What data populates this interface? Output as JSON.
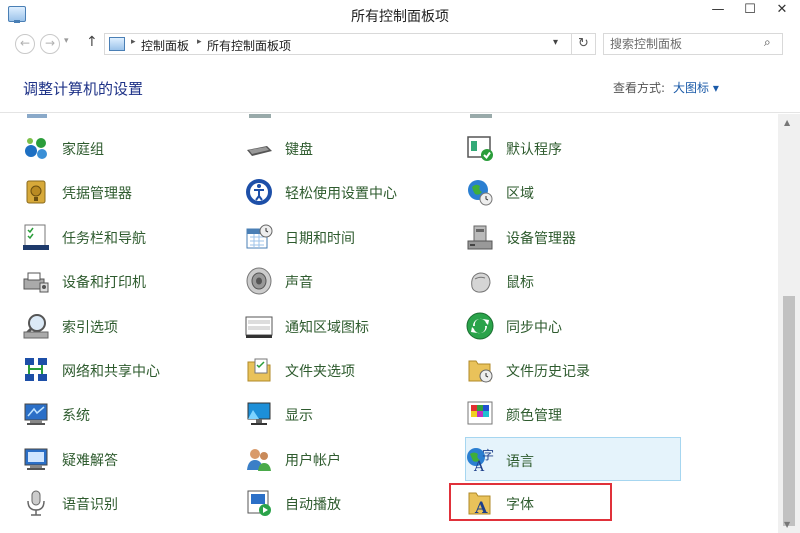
{
  "window": {
    "title": "所有控制面板项",
    "min": "—",
    "max": "☐",
    "close": "✕"
  },
  "nav": {
    "back": "←",
    "forward": "→",
    "history": "▾",
    "up": "↑"
  },
  "address": {
    "crumbs": [
      "控制面板",
      "所有控制面板项"
    ],
    "sep": "▸",
    "dropdown": "▾",
    "refresh": "↻"
  },
  "search": {
    "placeholder": "搜索控制面板",
    "icon": "⌕"
  },
  "header": {
    "title": "调整计算机的设置",
    "view_label": "查看方式:",
    "view_value": "大图标 ▾"
  },
  "items": [
    {
      "label": "家庭组",
      "icon": "homegroup-icon"
    },
    {
      "label": "键盘",
      "icon": "keyboard-icon"
    },
    {
      "label": "默认程序",
      "icon": "default-programs-icon"
    },
    {
      "label": "凭据管理器",
      "icon": "credential-manager-icon"
    },
    {
      "label": "轻松使用设置中心",
      "icon": "ease-of-access-icon"
    },
    {
      "label": "区域",
      "icon": "region-icon"
    },
    {
      "label": "任务栏和导航",
      "icon": "taskbar-icon"
    },
    {
      "label": "日期和时间",
      "icon": "date-time-icon"
    },
    {
      "label": "设备管理器",
      "icon": "device-manager-icon"
    },
    {
      "label": "设备和打印机",
      "icon": "devices-printers-icon"
    },
    {
      "label": "声音",
      "icon": "sound-icon"
    },
    {
      "label": "鼠标",
      "icon": "mouse-icon"
    },
    {
      "label": "索引选项",
      "icon": "indexing-icon"
    },
    {
      "label": "通知区域图标",
      "icon": "notification-area-icon"
    },
    {
      "label": "同步中心",
      "icon": "sync-center-icon"
    },
    {
      "label": "网络和共享中心",
      "icon": "network-center-icon"
    },
    {
      "label": "文件夹选项",
      "icon": "folder-options-icon"
    },
    {
      "label": "文件历史记录",
      "icon": "file-history-icon"
    },
    {
      "label": "系统",
      "icon": "system-icon"
    },
    {
      "label": "显示",
      "icon": "display-icon"
    },
    {
      "label": "颜色管理",
      "icon": "color-management-icon"
    },
    {
      "label": "疑难解答",
      "icon": "troubleshooting-icon"
    },
    {
      "label": "用户帐户",
      "icon": "user-accounts-icon"
    },
    {
      "label": "语言",
      "icon": "language-icon"
    },
    {
      "label": "语音识别",
      "icon": "speech-recognition-icon"
    },
    {
      "label": "自动播放",
      "icon": "autoplay-icon"
    },
    {
      "label": "字体",
      "icon": "fonts-icon"
    }
  ]
}
